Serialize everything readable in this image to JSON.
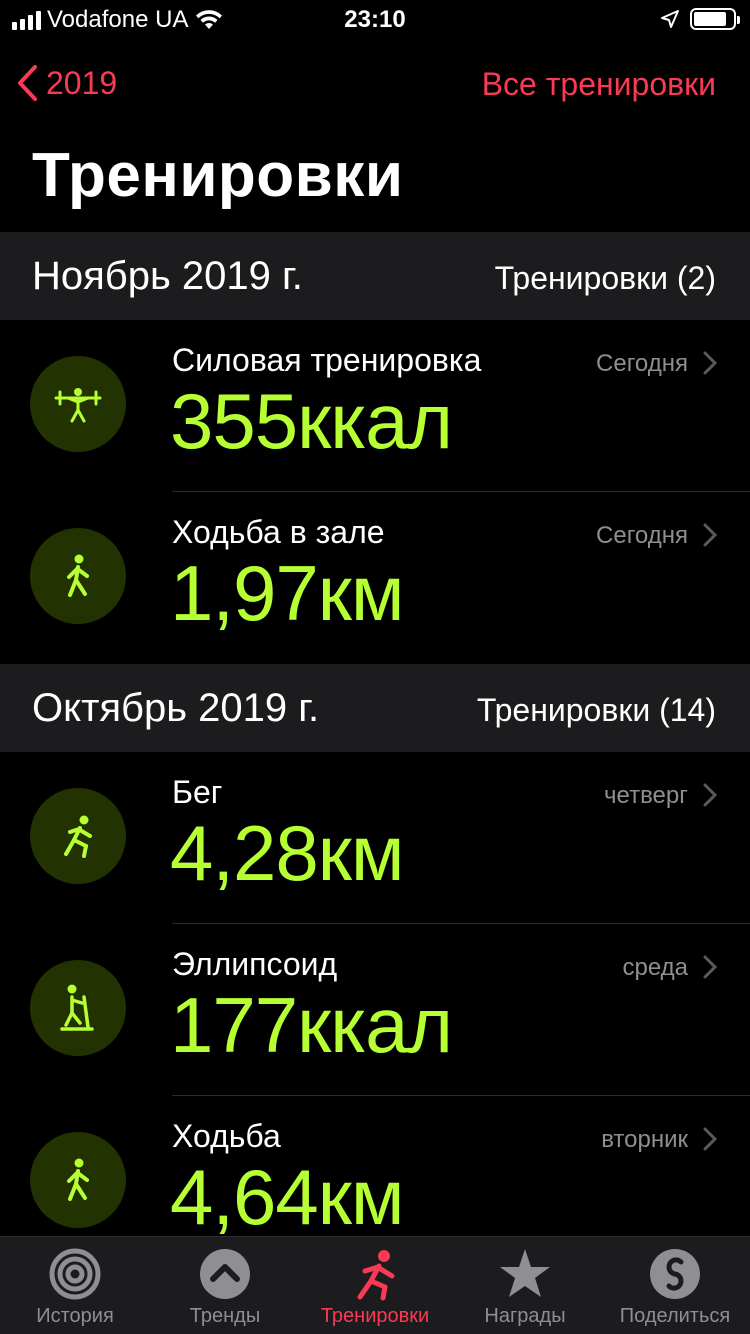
{
  "status": {
    "carrier": "Vodafone UA",
    "time": "23:10"
  },
  "nav": {
    "back_label": "2019",
    "right_label": "Все тренировки"
  },
  "title": "Тренировки",
  "sections": [
    {
      "month": "Ноябрь 2019 г.",
      "count": "Тренировки (2)",
      "workouts": [
        {
          "name": "Силовая тренировка",
          "value": "355ккал",
          "day": "Сегодня",
          "icon": "weightlifting-icon"
        },
        {
          "name": "Ходьба в зале",
          "value": "1,97км",
          "day": "Сегодня",
          "icon": "indoor-walk-icon"
        }
      ]
    },
    {
      "month": "Октябрь 2019 г.",
      "count": "Тренировки (14)",
      "workouts": [
        {
          "name": "Бег",
          "value": "4,28км",
          "day": "четверг",
          "icon": "running-icon"
        },
        {
          "name": "Эллипсоид",
          "value": "177ккал",
          "day": "среда",
          "icon": "elliptical-icon"
        },
        {
          "name": "Ходьба",
          "value": "4,64км",
          "day": "вторник",
          "icon": "walking-icon"
        }
      ]
    }
  ],
  "tabs": [
    {
      "label": "История",
      "icon": "activity-rings-icon"
    },
    {
      "label": "Тренды",
      "icon": "trends-icon"
    },
    {
      "label": "Тренировки",
      "icon": "workout-running-icon",
      "active": true
    },
    {
      "label": "Награды",
      "icon": "awards-star-icon"
    },
    {
      "label": "Поделиться",
      "icon": "sharing-icon"
    }
  ],
  "colors": {
    "accent": "#fa3a55",
    "metric": "#b6ff33",
    "icon_bg": "#223200",
    "section_bg": "#1c1c1e"
  }
}
